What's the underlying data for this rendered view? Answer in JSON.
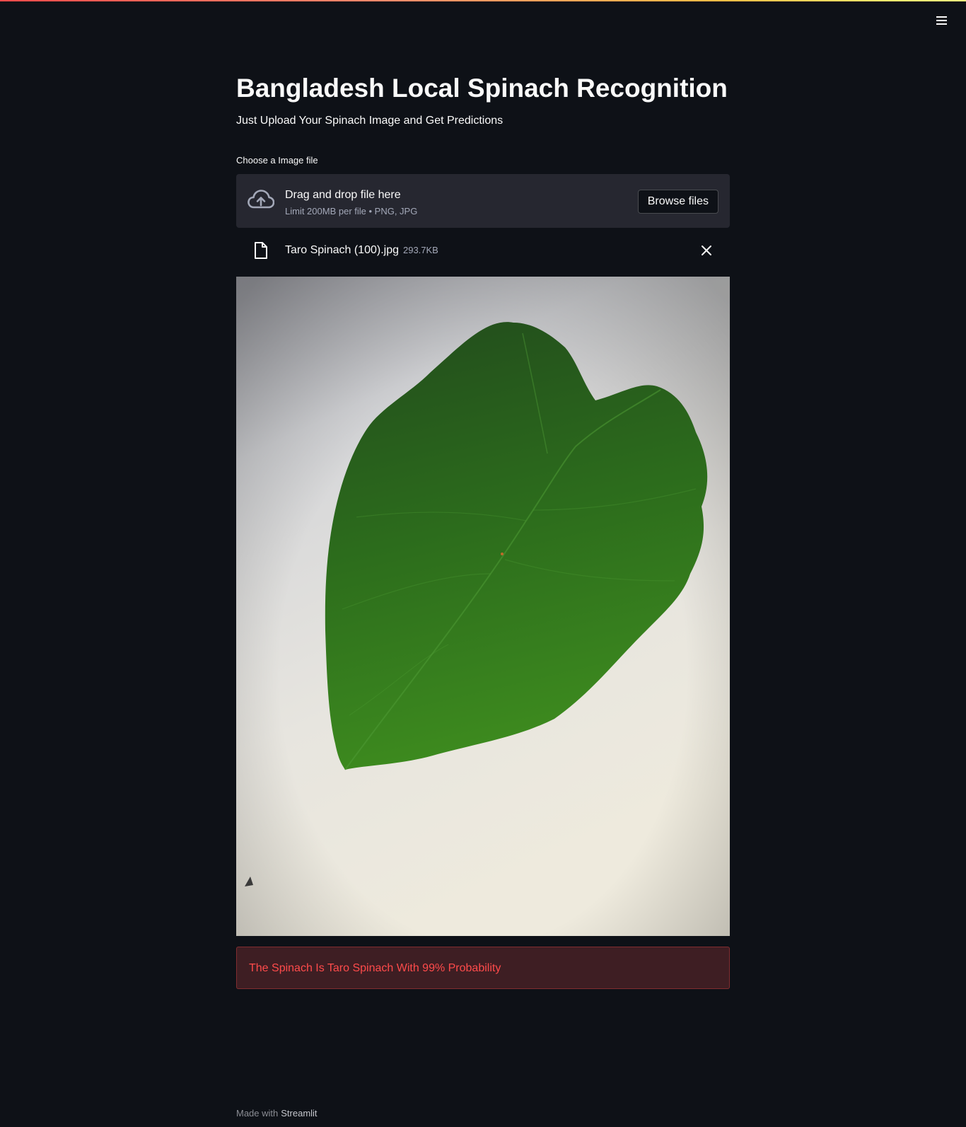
{
  "app": {
    "title": "Bangladesh Local Spinach Recognition",
    "subtitle": "Just Upload Your Spinach Image and Get Predictions"
  },
  "header": {
    "menu_icon": "hamburger-menu-icon"
  },
  "uploader": {
    "label": "Choose a Image file",
    "drop_text": "Drag and drop file here",
    "limit_text": "Limit 200MB per file • PNG, JPG",
    "browse_label": "Browse files",
    "upload_icon": "cloud-upload-icon"
  },
  "file": {
    "name": "Taro Spinach (100).jpg",
    "size": "293.7KB",
    "file_icon": "file-icon",
    "remove_icon": "close-icon"
  },
  "result": {
    "text": "The Spinach Is Taro Spinach With 99% Probability"
  },
  "footer": {
    "prefix": "Made with",
    "link": "Streamlit"
  },
  "colors": {
    "background": "#0e1117",
    "dropzone": "#262730",
    "error_text": "#ff4b4b",
    "error_bg": "#3e1e23"
  }
}
